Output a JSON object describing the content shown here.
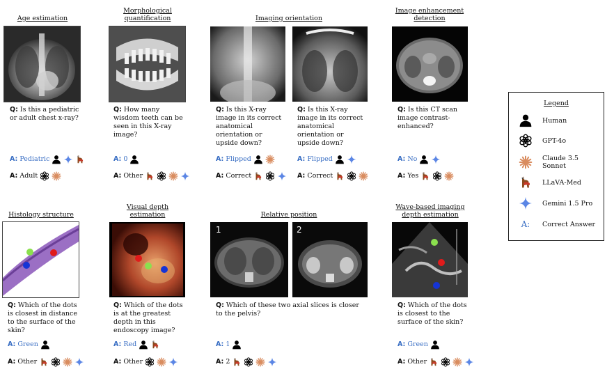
{
  "legend": {
    "title": "Legend",
    "items": [
      {
        "icon": "human-icon",
        "label": "Human"
      },
      {
        "icon": "gpt4o-icon",
        "label": "GPT-4o"
      },
      {
        "icon": "claude-icon",
        "label": "Claude 3.5 Sonnet"
      },
      {
        "icon": "llava-med-icon",
        "label": "LLaVA-Med"
      },
      {
        "icon": "gemini-icon",
        "label": "Gemini 1.5 Pro"
      },
      {
        "icon": "correct-answer-icon",
        "label": "Correct Answer",
        "glyph": "A:"
      }
    ]
  },
  "colors": {
    "correct": "#3a6fc4",
    "claude": "#d98c5f",
    "gemini": "#5b86e5",
    "dot_green": "#8be04e",
    "dot_red": "#e01b1b",
    "dot_blue": "#1534d6"
  },
  "panels": {
    "age": {
      "title": "Age estimation",
      "q_label": "Q:",
      "question": "Is this a pediatric or adult chest x-ray?",
      "a_label": "A:",
      "correct_answer": "Pediatric",
      "correct_models": [
        "human",
        "gemini",
        "llava"
      ],
      "other_answer": "Adult",
      "other_models": [
        "gpt",
        "claude"
      ]
    },
    "morph": {
      "title": "Morphological quantification",
      "q_label": "Q:",
      "question": "How many wisdom teeth can be seen in this X-ray image?",
      "a_label": "A:",
      "correct_answer": "0",
      "correct_models": [
        "human"
      ],
      "other_answer": "Other",
      "other_models": [
        "llava",
        "gpt",
        "claude",
        "gemini"
      ]
    },
    "orient": {
      "title": "Imaging orientation",
      "q_label": "Q:",
      "question1": "Is this X-ray image in its correct anatomical orientation or upside down?",
      "question2": "Is this X-ray image in its correct anatomical orientation or upside down?",
      "a_label": "A:",
      "correct_answer1": "Flipped",
      "correct_models1": [
        "human",
        "claude"
      ],
      "other_answer1": "Correct",
      "other_models1": [
        "llava",
        "gpt",
        "gemini"
      ],
      "correct_answer2": "Flipped",
      "correct_models2": [
        "human",
        "gemini"
      ],
      "other_answer2": "Correct",
      "other_models2": [
        "llava",
        "gpt",
        "claude"
      ]
    },
    "enhance": {
      "title": "Image enhancement detection",
      "q_label": "Q:",
      "question": "Is this CT scan image contrast-enhanced?",
      "a_label": "A:",
      "correct_answer": "No",
      "correct_models": [
        "human",
        "gemini"
      ],
      "other_answer": "Yes",
      "other_models": [
        "llava",
        "gpt",
        "claude"
      ]
    },
    "histo": {
      "title": "Histology structure",
      "q_label": "Q:",
      "question": "Which of the dots is closest in distance to the surface of the skin?",
      "a_label": "A:",
      "correct_answer": "Green",
      "correct_models": [
        "human"
      ],
      "other_answer": "Other",
      "other_models": [
        "llava",
        "gpt",
        "claude",
        "gemini"
      ]
    },
    "depth": {
      "title": "Visual depth estimation",
      "q_label": "Q:",
      "question": "Which of the dots is at the greatest depth in this endoscopy image?",
      "a_label": "A:",
      "correct_answer": "Red",
      "correct_models": [
        "human",
        "llava"
      ],
      "other_answer": "Other",
      "other_models": [
        "gpt",
        "claude",
        "gemini"
      ]
    },
    "relpos": {
      "title": "Relative position",
      "q_label": "Q:",
      "question": "Which of these two axial slices is closer to the pelvis?",
      "slice1": "1",
      "slice2": "2",
      "a_label": "A:",
      "correct_answer": "1",
      "correct_models": [
        "human"
      ],
      "other_answer": "2",
      "other_models": [
        "llava",
        "gpt",
        "claude",
        "gemini"
      ]
    },
    "wave": {
      "title": "Wave-based imaging depth estimation",
      "q_label": "Q:",
      "question": "Which of the dots is closest to the surface of the skin?",
      "a_label": "A:",
      "correct_answer": "Green",
      "correct_models": [
        "human"
      ],
      "other_answer": "Other",
      "other_models": [
        "llava",
        "gpt",
        "claude",
        "gemini"
      ]
    }
  }
}
